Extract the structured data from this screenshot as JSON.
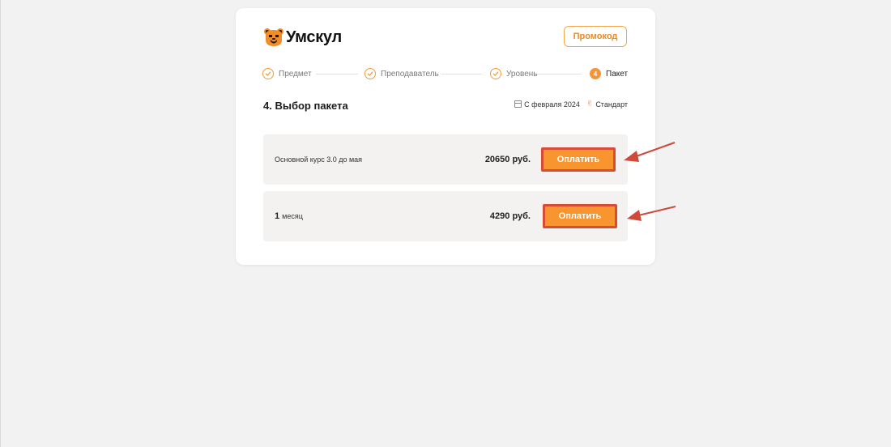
{
  "brand": {
    "name": "Умскул",
    "logo_color": "#f28c28"
  },
  "header": {
    "promo_label": "Промокод"
  },
  "steps": [
    {
      "label": "Предмет",
      "state": "done",
      "icon": "check-icon"
    },
    {
      "label": "Преподаватель",
      "state": "done",
      "icon": "check-icon"
    },
    {
      "label": "Уровень",
      "state": "done",
      "icon": "check-icon"
    },
    {
      "label": "Пакет",
      "state": "active",
      "number": "4"
    }
  ],
  "section": {
    "title": "4. Выбор пакета",
    "date_label": "С февраля 2024",
    "tier_label": "Стандарт"
  },
  "packages": [
    {
      "name": "Основной курс 3.0 до мая",
      "price": "20650 руб.",
      "button_label": "Оплатить"
    },
    {
      "name_number": "1",
      "name": "месяц",
      "price": "4290 руб.",
      "button_label": "Оплатить"
    }
  ],
  "colors": {
    "accent": "#f8952f",
    "highlight_border": "#d94b36",
    "annotation_arrow": "#d04a3c"
  }
}
